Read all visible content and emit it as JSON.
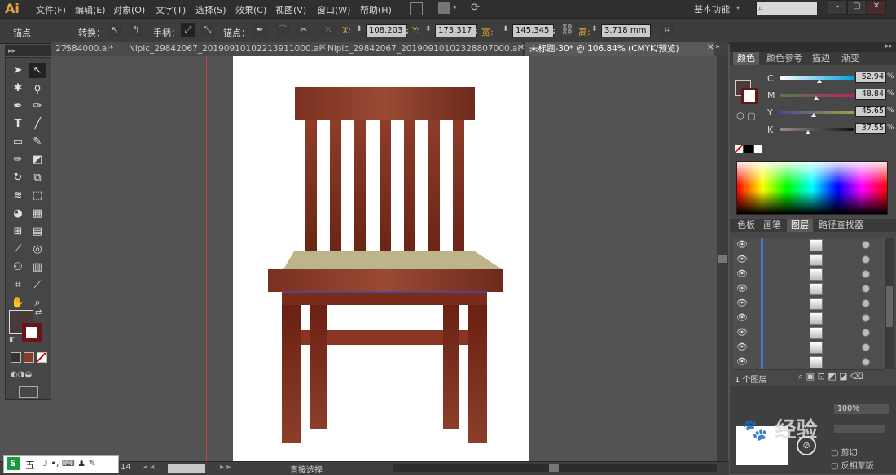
{
  "app": {
    "logo": "Ai",
    "workspace": "基本功能",
    "search_placeholder": ""
  },
  "menu": [
    "文件(F)",
    "编辑(E)",
    "对象(O)",
    "文字(T)",
    "选择(S)",
    "效果(C)",
    "视图(V)",
    "窗口(W)",
    "帮助(H)"
  ],
  "control": {
    "selection_label": "锚点",
    "convert_label": "转换：",
    "handles_label": "手柄：",
    "anchors_label": "锚点：",
    "x_label": "X:",
    "x_value": "108.203",
    "y_label": "Y:",
    "y_value": "173.317",
    "w_label": "宽:",
    "w_value": "145.345",
    "h_label": "高:",
    "h_value": "3.718",
    "unit_short": "s",
    "unit_mm": "mm"
  },
  "tabs": [
    {
      "label": "27584000.ai*",
      "active": false
    },
    {
      "label": "Nipic_29842067_20190910102213911000.ai*",
      "active": false
    },
    {
      "label": "Nipic_29842067_20190910102328807000.ai*",
      "active": false
    },
    {
      "label": "未标题-30* @ 106.84% (CMYK/预览)",
      "active": true
    }
  ],
  "color_panel": {
    "tabs": [
      "颜色",
      "颜色参考",
      "描边",
      "渐变"
    ],
    "channels": [
      {
        "name": "C",
        "value": "52.94",
        "pos": 0.53
      },
      {
        "name": "M",
        "value": "48.84",
        "pos": 0.49
      },
      {
        "name": "Y",
        "value": "45.65",
        "pos": 0.46
      },
      {
        "name": "K",
        "value": "37.55",
        "pos": 0.38
      }
    ],
    "percent": "%"
  },
  "layers_panel": {
    "tabs": [
      "色板",
      "画笔",
      "图层",
      "路径查找器"
    ],
    "count_label": "1 个图层"
  },
  "bottom_panel": {
    "opacity_value": "100%",
    "clip_label": "剪切",
    "invert_label": "反相蒙版"
  },
  "status": {
    "zoom": "14",
    "mode": "直接选择"
  },
  "ime_label": "五",
  "watermark_text": "经验",
  "colors": {
    "chair_wood": "#8a3a28",
    "seat": "#bdb48a",
    "accent": "#e8a341",
    "guide": "#c8434a"
  }
}
